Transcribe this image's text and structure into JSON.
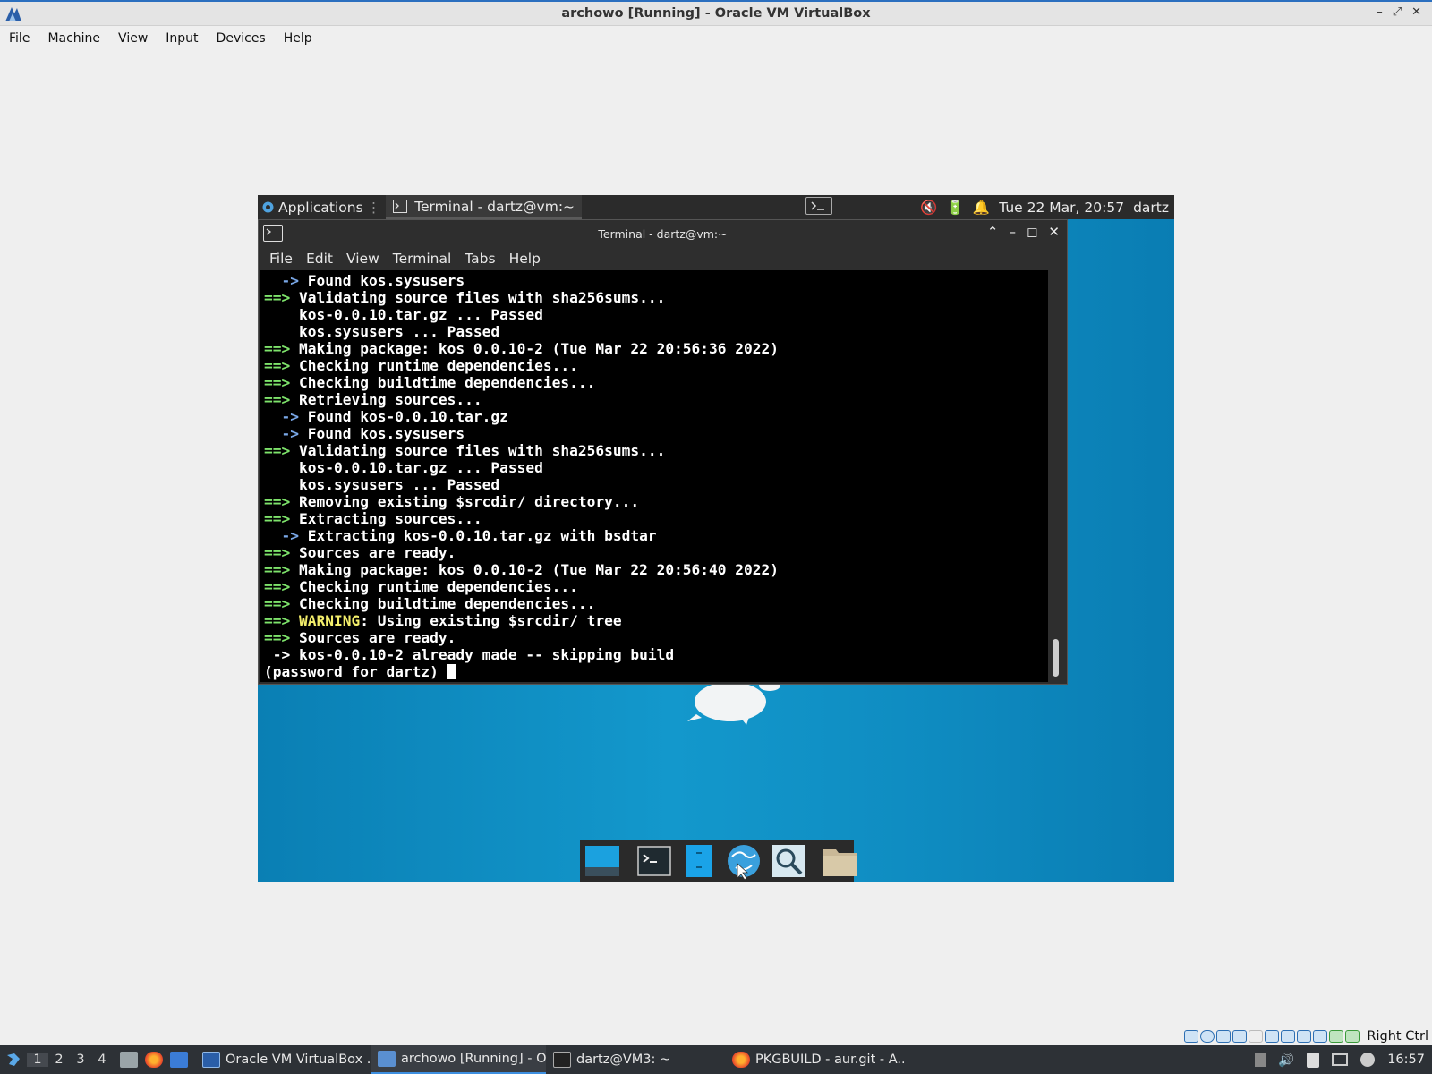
{
  "host": {
    "title": "archowo [Running] - Oracle VM VirtualBox",
    "menu": [
      "File",
      "Machine",
      "View",
      "Input",
      "Devices",
      "Help"
    ],
    "status_right_label": "Right Ctrl"
  },
  "guest_panel": {
    "applications_label": "Applications",
    "task_label": "Terminal - dartz@vm:~",
    "datetime": "Tue 22 Mar, 20:57",
    "user": "dartz"
  },
  "terminal": {
    "title": "Terminal - dartz@vm:~",
    "menu": [
      "File",
      "Edit",
      "View",
      "Terminal",
      "Tabs",
      "Help"
    ],
    "lines": [
      {
        "prefix": "  ->",
        "prefix_color": "blue",
        "text": " Found kos.sysusers"
      },
      {
        "prefix": "==>",
        "prefix_color": "green",
        "text": " Validating source files with sha256sums..."
      },
      {
        "prefix": "",
        "prefix_color": "",
        "text": "    kos-0.0.10.tar.gz ... Passed"
      },
      {
        "prefix": "",
        "prefix_color": "",
        "text": "    kos.sysusers ... Passed"
      },
      {
        "prefix": "==>",
        "prefix_color": "green",
        "text": " Making package: kos 0.0.10-2 (Tue Mar 22 20:56:36 2022)"
      },
      {
        "prefix": "==>",
        "prefix_color": "green",
        "text": " Checking runtime dependencies..."
      },
      {
        "prefix": "==>",
        "prefix_color": "green",
        "text": " Checking buildtime dependencies..."
      },
      {
        "prefix": "==>",
        "prefix_color": "green",
        "text": " Retrieving sources..."
      },
      {
        "prefix": "  ->",
        "prefix_color": "blue",
        "text": " Found kos-0.0.10.tar.gz"
      },
      {
        "prefix": "  ->",
        "prefix_color": "blue",
        "text": " Found kos.sysusers"
      },
      {
        "prefix": "==>",
        "prefix_color": "green",
        "text": " Validating source files with sha256sums..."
      },
      {
        "prefix": "",
        "prefix_color": "",
        "text": "    kos-0.0.10.tar.gz ... Passed"
      },
      {
        "prefix": "",
        "prefix_color": "",
        "text": "    kos.sysusers ... Passed"
      },
      {
        "prefix": "==>",
        "prefix_color": "green",
        "text": " Removing existing $srcdir/ directory..."
      },
      {
        "prefix": "==>",
        "prefix_color": "green",
        "text": " Extracting sources..."
      },
      {
        "prefix": "  ->",
        "prefix_color": "blue",
        "text": " Extracting kos-0.0.10.tar.gz with bsdtar"
      },
      {
        "prefix": "==>",
        "prefix_color": "green",
        "text": " Sources are ready."
      },
      {
        "prefix": "==>",
        "prefix_color": "green",
        "text": " Making package: kos 0.0.10-2 (Tue Mar 22 20:56:40 2022)"
      },
      {
        "prefix": "==>",
        "prefix_color": "green",
        "text": " Checking runtime dependencies..."
      },
      {
        "prefix": "==>",
        "prefix_color": "green",
        "text": " Checking buildtime dependencies..."
      },
      {
        "prefix": "==>",
        "prefix_color": "green",
        "warning": "WARNING",
        "text": ": Using existing $srcdir/ tree"
      },
      {
        "prefix": "==>",
        "prefix_color": "green",
        "text": " Sources are ready."
      },
      {
        "prefix": " ->",
        "prefix_color": "white",
        "text": " kos-0.0.10-2 already made -- skipping build"
      }
    ],
    "prompt": "(password for dartz) "
  },
  "host_taskbar": {
    "workspaces": [
      "1",
      "2",
      "3",
      "4"
    ],
    "tasks": [
      {
        "label": "Oracle VM VirtualBox ...",
        "icon": "virtualbox-manager-icon"
      },
      {
        "label": "archowo [Running] - O...",
        "icon": "virtualbox-vm-icon"
      },
      {
        "label": "dartz@VM3: ~",
        "icon": "terminal-icon"
      },
      {
        "label": "PKGBUILD - aur.git - A...",
        "icon": "firefox-icon"
      }
    ],
    "clock": "16:57"
  },
  "colors": {
    "green_prompt": "#7ee36b",
    "blue_arrow": "#7aa8e8",
    "warning": "#f4ef6b",
    "desktop": "#0e86bb"
  }
}
